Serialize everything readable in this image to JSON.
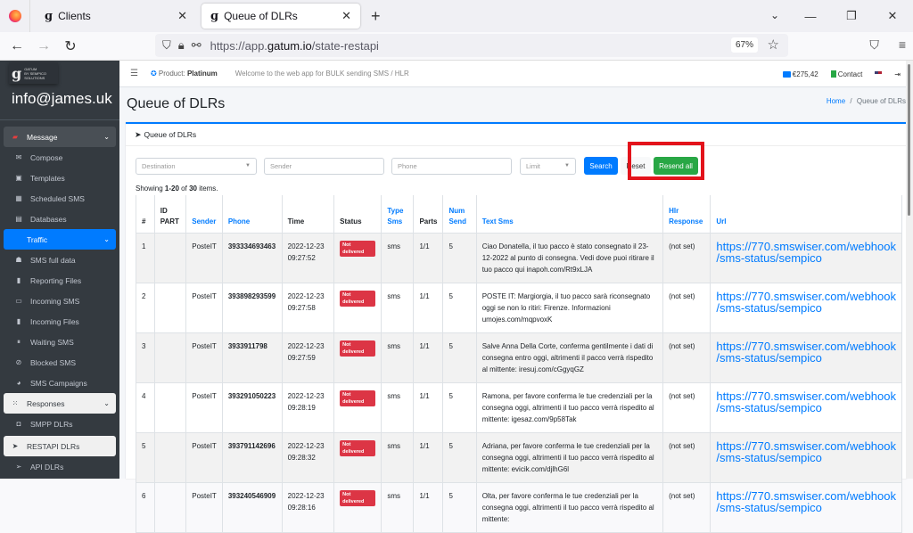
{
  "browser": {
    "tabs": [
      {
        "label": "Clients",
        "active": false
      },
      {
        "label": "Queue of DLRs",
        "active": true
      }
    ],
    "url_prefix": "https://app.",
    "url_domain": "gatum.io",
    "url_path": "/state-restapi",
    "zoom_level": "67%"
  },
  "sidebar": {
    "brand_name": "GATUM",
    "brand_tagline": "BY SEMPICO SOLUTIONS",
    "user": "info@james.uk",
    "items": [
      {
        "label": "Message",
        "icon": "message-icon",
        "type": "head"
      },
      {
        "label": "Compose",
        "icon": "envelope-icon"
      },
      {
        "label": "Templates",
        "icon": "template-icon"
      },
      {
        "label": "Scheduled SMS",
        "icon": "calendar-icon"
      },
      {
        "label": "Databases",
        "icon": "clipboard-icon"
      },
      {
        "label": "Traffic",
        "icon": "",
        "type": "active"
      },
      {
        "label": "SMS full data",
        "icon": "ghost-icon"
      },
      {
        "label": "Reporting Files",
        "icon": "file-icon"
      },
      {
        "label": "Incoming SMS",
        "icon": "inbox-icon"
      },
      {
        "label": "Incoming Files",
        "icon": "file-icon"
      },
      {
        "label": "Waiting SMS",
        "icon": "pause-icon"
      },
      {
        "label": "Blocked SMS",
        "icon": "ban-icon"
      },
      {
        "label": "SMS Campaigns",
        "icon": "campaign-icon"
      },
      {
        "label": "Responses",
        "icon": "blackberry-icon",
        "type": "light-head"
      },
      {
        "label": "SMPP DLRs",
        "icon": "square-icon"
      },
      {
        "label": "RESTAPI DLRs",
        "icon": "paper-plane-icon",
        "type": "light"
      },
      {
        "label": "API DLRs",
        "icon": "paper-plane-outline-icon"
      }
    ]
  },
  "topnav": {
    "product_label": "Product:",
    "product_value": "Platinum",
    "welcome": "Welcome to the web app for BULK sending SMS / HLR",
    "balance": "€275,42",
    "contact": "Contact"
  },
  "page": {
    "title": "Queue of DLRs",
    "breadcrumb_home": "Home",
    "breadcrumb_sep": "/",
    "breadcrumb_current": "Queue of DLRs",
    "card_title": "Queue of DLRs"
  },
  "filters": {
    "destination_placeholder": "Destination",
    "sender_placeholder": "Sender",
    "phone_placeholder": "Phone",
    "limit_placeholder": "Limit",
    "search_label": "Search",
    "reset_label": "Reset",
    "resend_all_label": "Resend all"
  },
  "summary": {
    "prefix": "Showing ",
    "range": "1-20",
    "middle": " of ",
    "total": "30",
    "suffix": " items."
  },
  "table": {
    "columns": [
      "#",
      "ID PART",
      "Sender",
      "Phone",
      "Time",
      "Status",
      "Type Sms",
      "Parts",
      "Num Send",
      "Text Sms",
      "Hlr Response",
      "Url"
    ],
    "rows": [
      {
        "n": "1",
        "id_part": "",
        "sender": "PosteIT",
        "phone": "393334693463",
        "date": "2022-12-23",
        "time": "09:27:52",
        "status": "Not delivered",
        "type": "sms",
        "parts": "1/1",
        "num_send": "5",
        "text": "Ciao Donatella, il tuo pacco è stato consegnato il 23-12-2022 al punto di consegna. Vedi dove puoi ritirare il tuo pacco qui inapoh.com/Rt9xLJA",
        "hlr": "(not set)",
        "url1": "https://770.smswiser.com/webhook",
        "url2": "/sms-status/sempico"
      },
      {
        "n": "2",
        "id_part": "",
        "sender": "PosteIT",
        "phone": "393898293599",
        "date": "2022-12-23",
        "time": "09:27:58",
        "status": "Not delivered",
        "type": "sms",
        "parts": "1/1",
        "num_send": "5",
        "text": "POSTE IT: Margiorgia, il tuo pacco sarà riconsegnato oggi se non lo ritiri: Firenze. Informazioni umojes.com/mqpvoxK",
        "hlr": "(not set)",
        "url1": "https://770.smswiser.com/webhook",
        "url2": "/sms-status/sempico"
      },
      {
        "n": "3",
        "id_part": "",
        "sender": "PosteIT",
        "phone": "3933911798",
        "date": "2022-12-23",
        "time": "09:27:59",
        "status": "Not delivered",
        "type": "sms",
        "parts": "1/1",
        "num_send": "5",
        "text": "Salve Anna Della Corte, conferma gentilmente i dati di consegna entro oggi, altrimenti il pacco verrà rispedito al mittente: iresuj.com/cGgyqGZ",
        "hlr": "(not set)",
        "url1": "https://770.smswiser.com/webhook",
        "url2": "/sms-status/sempico"
      },
      {
        "n": "4",
        "id_part": "",
        "sender": "PosteIT",
        "phone": "393291050223",
        "date": "2022-12-23",
        "time": "09:28:19",
        "status": "Not delivered",
        "type": "sms",
        "parts": "1/1",
        "num_send": "5",
        "text": "Ramona, per favore conferma le tue credenziali per la consegna oggi, altrimenti il tuo pacco verrà rispedito al mittente: igesaz.com/9p58Tak",
        "hlr": "(not set)",
        "url1": "https://770.smswiser.com/webhook",
        "url2": "/sms-status/sempico"
      },
      {
        "n": "5",
        "id_part": "",
        "sender": "PosteIT",
        "phone": "393791142696",
        "date": "2022-12-23",
        "time": "09:28:32",
        "status": "Not delivered",
        "type": "sms",
        "parts": "1/1",
        "num_send": "5",
        "text": "Adriana, per favore conferma le tue credenziali per la consegna oggi, altrimenti il tuo pacco verrà rispedito al mittente: evicik.com/djlhG6l",
        "hlr": "(not set)",
        "url1": "https://770.smswiser.com/webhook",
        "url2": "/sms-status/sempico"
      },
      {
        "n": "6",
        "id_part": "",
        "sender": "PosteIT",
        "phone": "393240546909",
        "date": "2022-12-23",
        "time": "09:28:16",
        "status": "Not delivered",
        "type": "sms",
        "parts": "1/1",
        "num_send": "5",
        "text": "Olta, per favore conferma le tue credenziali per la consegna oggi, altrimenti il tuo pacco verrà rispedito al mittente:",
        "hlr": "(not set)",
        "url1": "https://770.smswiser.com/webhook",
        "url2": "/sms-status/sempico"
      }
    ]
  },
  "colors": {
    "primary": "#007bff",
    "success": "#28a745",
    "danger": "#dc3545",
    "sidebar_bg": "#343a40",
    "highlight": "#e3131b"
  }
}
